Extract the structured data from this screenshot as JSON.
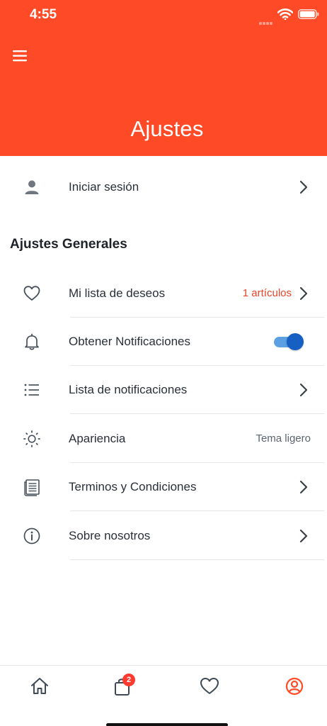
{
  "status_bar": {
    "time": "4:55"
  },
  "header": {
    "title": "Ajustes",
    "background_color": "#ff4a27"
  },
  "account": {
    "label": "Iniciar sesión",
    "icon": "person-icon"
  },
  "general": {
    "title": "Ajustes Generales",
    "items": [
      {
        "label": "Mi lista de deseos",
        "icon": "heart-icon",
        "value": "1 artículos",
        "value_color": "#e8442a"
      },
      {
        "label": "Obtener Notificaciones",
        "icon": "bell-icon",
        "toggle_on": true
      },
      {
        "label": "Lista de notificaciones",
        "icon": "list-icon"
      },
      {
        "label": "Apariencia",
        "icon": "sun-icon",
        "value": "Tema ligero",
        "value_color": "#5b6470"
      },
      {
        "label": "Terminos y Condiciones",
        "icon": "document-icon"
      },
      {
        "label": "Sobre nosotros",
        "icon": "info-icon"
      }
    ]
  },
  "tab_bar": {
    "tabs": [
      {
        "name": "home",
        "icon": "home-icon"
      },
      {
        "name": "cart",
        "icon": "bag-icon",
        "badge": "2"
      },
      {
        "name": "wishlist",
        "icon": "heart-icon"
      },
      {
        "name": "profile",
        "icon": "profile-icon",
        "active": true
      }
    ],
    "active_color": "#ff4a27"
  }
}
